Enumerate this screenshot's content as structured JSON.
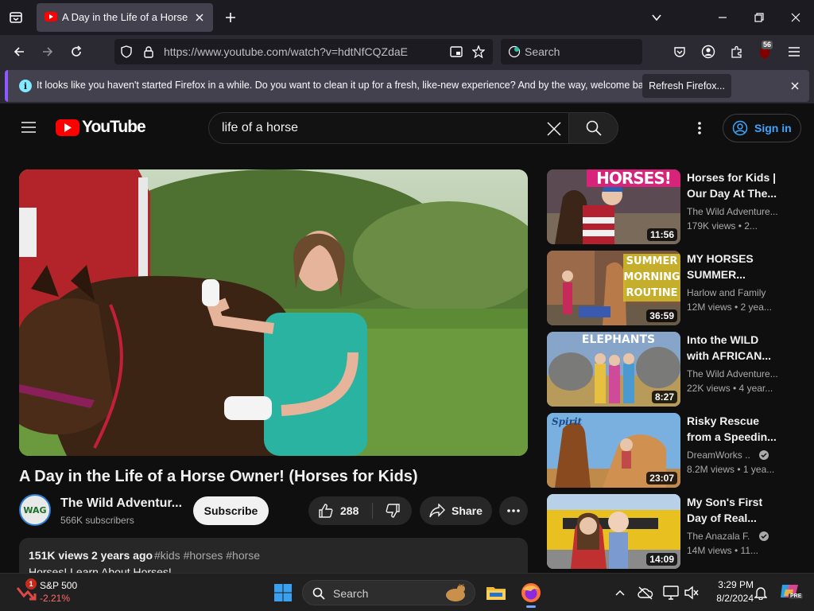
{
  "browser": {
    "tab_title": "A Day in the Life of a Horse Ow",
    "url": "https://www.youtube.com/watch?v=hdtNfCQZdaE",
    "search_placeholder": "Search",
    "extension_badge": "56"
  },
  "notification": {
    "message": "It looks like you haven't started Firefox in a while. Do you want to clean it up for a fresh, like-new experience? And by the way, welcome back!",
    "button_label": "Refresh Firefox..."
  },
  "youtube": {
    "logo_text": "YouTube",
    "search_query": "life of a horse",
    "sign_in_label": "Sign in",
    "video": {
      "title": "A Day in the Life of a Horse Owner! (Horses for Kids)",
      "channel_name": "The Wild Adventur...",
      "subscribers": "566K subscribers",
      "channel_avatar_text": "WAG",
      "subscribe_label": "Subscribe",
      "like_count": "288",
      "share_label": "Share",
      "views": "151K views",
      "age": "2 years ago",
      "hashtags": "#kids #horses #horse",
      "description_preview": "Horses! Learn About Horses!"
    },
    "recommendations": [
      {
        "title": "Horses for Kids | Our Day At The...",
        "channel": "The Wild Adventure...",
        "meta": "179K views  • 2...",
        "duration": "11:56",
        "thumb_text": "HORSES!"
      },
      {
        "title": "MY HORSES SUMMER...",
        "channel": "Harlow and Family",
        "meta": "12M views  • 2 yea...",
        "duration": "36:59",
        "thumb_text": "SUMMER MORNING ROUTINE"
      },
      {
        "title": "Into the WILD with AFRICAN...",
        "channel": "The Wild Adventure...",
        "meta": "22K views  • 4 year...",
        "duration": "8:27",
        "thumb_text": "ELEPHANTS"
      },
      {
        "title": "Risky Rescue from a Speedin...",
        "channel": "DreamWorks ...",
        "meta": "8.2M views  • 1 yea...",
        "duration": "23:07",
        "thumb_text": "Spirit"
      },
      {
        "title": "My Son's First Day of Real...",
        "channel": "The Anazala F...",
        "meta": "14M views  • 11...",
        "duration": "14:09",
        "thumb_text": ""
      }
    ]
  },
  "taskbar": {
    "stock_name": "S&P 500",
    "stock_change": "-2.21%",
    "stock_badge": "1",
    "search_placeholder": "Search",
    "time": "3:29 PM",
    "date": "8/2/2024"
  },
  "colors": {
    "youtube_red": "#ff0000",
    "sign_in_blue": "#3ea6ff",
    "stock_down": "#ff6b6b",
    "firefox_bg": "#2b2a33"
  }
}
